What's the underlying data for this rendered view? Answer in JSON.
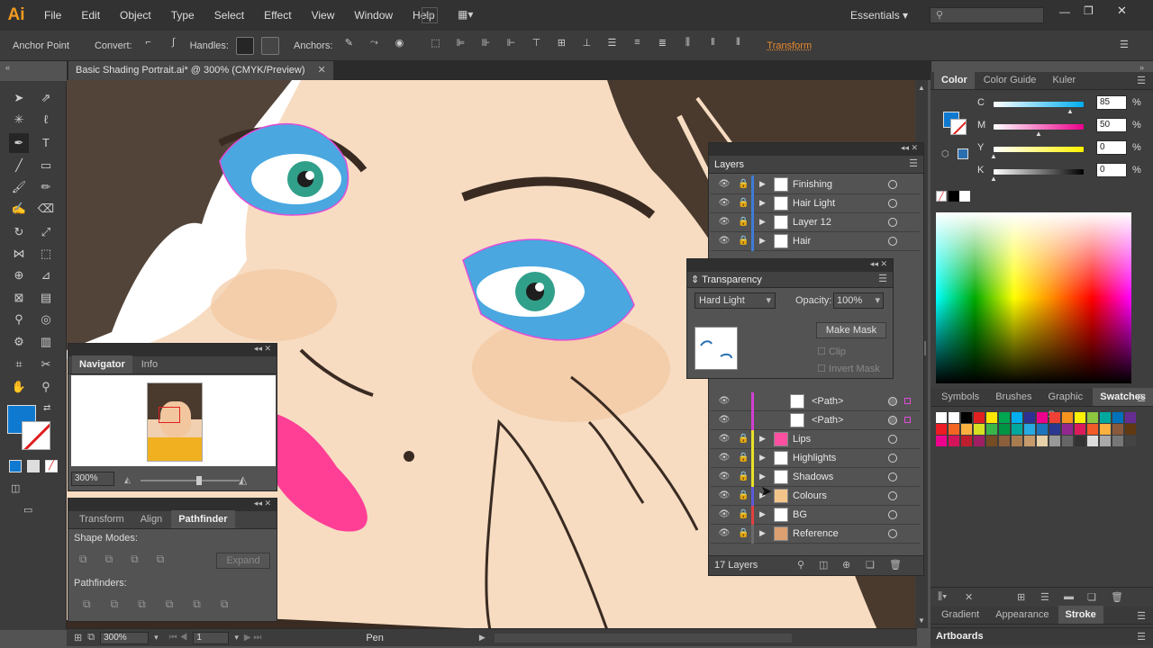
{
  "app": {
    "logo": "Ai"
  },
  "menu": [
    "File",
    "Edit",
    "Object",
    "Type",
    "Select",
    "Effect",
    "View",
    "Window",
    "Help"
  ],
  "br_badge": "Br",
  "workspace": "Essentials",
  "search": {
    "placeholder": ""
  },
  "control": {
    "anchor_point": "Anchor Point",
    "convert": "Convert:",
    "handles": "Handles:",
    "anchors": "Anchors:",
    "transform": "Transform"
  },
  "document": {
    "tab_title": "Basic Shading Portrait.ai* @ 300% (CMYK/Preview)",
    "close": "✕"
  },
  "navigator": {
    "tabs": [
      "Navigator",
      "Info"
    ],
    "zoom": "300%"
  },
  "pathfinder": {
    "tabs": [
      "Transform",
      "Align",
      "Pathfinder"
    ],
    "shape_modes": "Shape Modes:",
    "expand": "Expand",
    "pathfinders": "Pathfinders:"
  },
  "layers": {
    "title": "Layers",
    "count": "17 Layers",
    "rows": [
      {
        "name": "Finishing",
        "color": "#3f7bd6",
        "thumb": "#ffffff"
      },
      {
        "name": "Hair Light",
        "color": "#3f7bd6",
        "thumb": "#ffffff"
      },
      {
        "name": "Layer 12",
        "color": "#3f7bd6",
        "thumb": "#ffffff"
      },
      {
        "name": "Hair",
        "color": "#3f7bd6",
        "thumb": "#ffffff"
      },
      {
        "name": "<Path>",
        "color": "#d040d0",
        "thumb": "#ffffff"
      },
      {
        "name": "<Path>",
        "color": "#d040d0",
        "thumb": "#ffffff"
      },
      {
        "name": "Lips",
        "color": "#e8e12a",
        "thumb": "#ff4fa0"
      },
      {
        "name": "Highlights",
        "color": "#e8e12a",
        "thumb": "#ffffff"
      },
      {
        "name": "Shadows",
        "color": "#e8e12a",
        "thumb": "#ffffff"
      },
      {
        "name": "Colours",
        "color": "#5a5ad8",
        "thumb": "#f4c58a"
      },
      {
        "name": "BG",
        "color": "#e04040",
        "thumb": "#ffffff"
      },
      {
        "name": "Reference",
        "color": "#6a6a6a",
        "thumb": "#dca070"
      }
    ]
  },
  "transparency": {
    "title": "Transparency",
    "blend_mode": "Hard Light",
    "opacity_label": "Opacity:",
    "opacity": "100%",
    "make_mask": "Make Mask",
    "clip": "Clip",
    "invert_mask": "Invert Mask"
  },
  "color_panel": {
    "tabs": [
      "Color",
      "Color Guide",
      "Kuler"
    ],
    "channels": [
      {
        "label": "C",
        "value": "85",
        "fraction": 0.85
      },
      {
        "label": "M",
        "value": "50",
        "fraction": 0.5
      },
      {
        "label": "Y",
        "value": "0",
        "fraction": 0
      },
      {
        "label": "K",
        "value": "0",
        "fraction": 0
      }
    ],
    "percent": "%"
  },
  "swatches_panel": {
    "tabs": [
      "Symbols",
      "Brushes",
      "Graphic S",
      "Swatches"
    ]
  },
  "bottom_panels": {
    "tabs": [
      "Gradient",
      "Appearance",
      "Stroke"
    ],
    "artboards": "Artboards"
  },
  "status": {
    "zoom": "300%",
    "artboard": "1",
    "tool": "Pen"
  },
  "colors": {
    "accent_blue": "#0f79d0",
    "transform_orange": "#e88a2e",
    "skin": "#f7dcc2",
    "hair": "#4a3a2e",
    "lip": "#ff3f96",
    "eye_shadow": "#4aa7e0",
    "selection": "#e24dd8"
  }
}
